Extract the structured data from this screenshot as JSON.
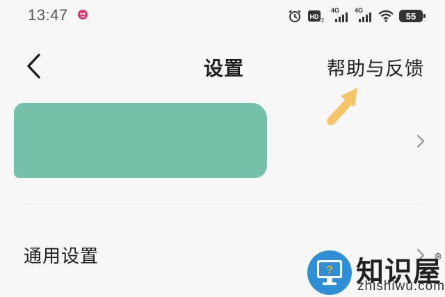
{
  "status_bar": {
    "time": "13:47",
    "network_1": "4G",
    "network_2": "4G",
    "battery": "55",
    "icons": [
      "notification-app-icon",
      "alarm-icon",
      "hd-icon",
      "signal-icon",
      "signal-icon",
      "wifi-icon",
      "battery-icon"
    ]
  },
  "nav": {
    "back_icon": "chevron-left-icon",
    "title": "设置",
    "help_label": "帮助与反馈"
  },
  "annotation": {
    "arrow_color": "#f7c46a"
  },
  "account": {
    "redaction_color": "#74c0aa",
    "chevron_icon": "chevron-right-icon"
  },
  "rows": [
    {
      "label": "通用设置",
      "chevron_icon": "chevron-right-icon"
    }
  ],
  "watermark": {
    "title": "知识屋",
    "reg": "®",
    "url": "zhishiwu.com",
    "icon": "monitor-question-icon"
  }
}
